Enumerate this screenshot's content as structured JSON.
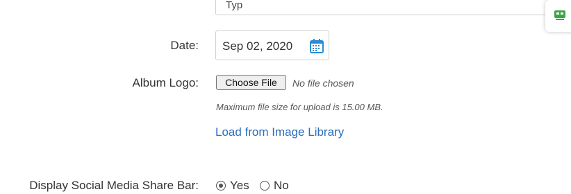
{
  "top_field": {
    "value_fragment": "Typ"
  },
  "form": {
    "date": {
      "label": "Date:",
      "value": "Sep 02, 2020"
    },
    "album_logo": {
      "label": "Album Logo:",
      "choose_button": "Choose File",
      "no_file_text": "No file chosen",
      "hint": "Maximum file size for upload is 15.00 MB.",
      "library_link": "Load from Image Library"
    },
    "social_share": {
      "label": "Display Social Media Share Bar:",
      "options": [
        {
          "label": "Yes",
          "selected": true
        },
        {
          "label": "No",
          "selected": false
        }
      ]
    }
  },
  "colors": {
    "link": "#2a6ebb",
    "calendar_icon": "#2a8dd4",
    "widget_icon": "#3aa64a"
  },
  "icons": {
    "calendar": "calendar-icon",
    "widget": "robot-icon"
  }
}
